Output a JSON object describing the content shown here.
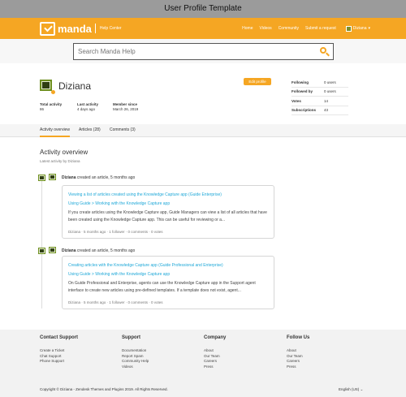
{
  "window": {
    "title": "User Profile Template"
  },
  "header": {
    "logo_text": "manda",
    "logo_sub": "Help Center",
    "nav": [
      "Home",
      "Videos",
      "Community",
      "Submit a request"
    ],
    "user_name": "Diziana",
    "brand_color": "#f5a623"
  },
  "search": {
    "placeholder": "Search Manda Help",
    "icon": "search-icon"
  },
  "profile": {
    "name": "Diziana",
    "edit_label": "Edit profile",
    "stats": [
      {
        "label": "Total activity",
        "value": "86"
      },
      {
        "label": "Last activity",
        "value": "4 days ago"
      },
      {
        "label": "Member since",
        "value": "March 26, 2019"
      }
    ],
    "side_stats": [
      {
        "label": "Following",
        "value": "0 users"
      },
      {
        "label": "Followed by",
        "value": "0 users"
      },
      {
        "label": "Votes",
        "value": "14"
      },
      {
        "label": "Subscriptions",
        "value": "43"
      }
    ]
  },
  "tabs": [
    {
      "label": "Activity overview"
    },
    {
      "label": "Articles (28)"
    },
    {
      "label": "Comments (3)"
    }
  ],
  "activity": {
    "title": "Activity overview",
    "subtitle": "Latest activity by Diziana",
    "items": [
      {
        "author": "Diziana",
        "action": "created an article, 5 months ago",
        "title": "Viewing a list of articles created using the Knowledge Capture app (Guide Enterprise)",
        "crumb": "Using Guide  >  Working with the Knowledge Capture app",
        "body": "If you create articles using the Knowledge Capture app, Guide Managers can view a list of all articles that have been created using the Knowledge Capture app. This can be useful for reviewing or a...",
        "meta": "Diziana  ·  5 months ago  ·  1 follower  ·  0 comments  ·  0 votes"
      },
      {
        "author": "Diziana",
        "action": "created an article, 5 months ago",
        "title": "Creating articles with the Knowledge Capture app (Guide Professional and Enterprise)",
        "crumb": "Using Guide  >  Working with the Knowledge Capture app",
        "body": "On Guide Professional and Enterprise, agents can use the Knowledge Capture app in the Support agent interface to create new articles using pre-defined templates. If a template does not exist, agent...",
        "meta": "Diziana  ·  5 months ago  ·  1 follower  ·  0 comments  ·  0 votes"
      }
    ]
  },
  "footer": {
    "columns": [
      {
        "heading": "Contact Support",
        "links": [
          "Create a Ticket",
          "Chat Support",
          "Phone Support"
        ]
      },
      {
        "heading": "Support",
        "links": [
          "Documentation",
          "Report Spam",
          "Community Help",
          "Videos"
        ]
      },
      {
        "heading": "Company",
        "links": [
          "About",
          "Our Team",
          "Careers",
          "Press"
        ]
      },
      {
        "heading": "Follow Us",
        "links": [
          "About",
          "Our Team",
          "Careers",
          "Press"
        ]
      }
    ],
    "copyright": "Copyright © Diziana - Zendesk Themes and Plugins 2019. All Rights Reserved.",
    "language": "English (US)  ⌄"
  }
}
